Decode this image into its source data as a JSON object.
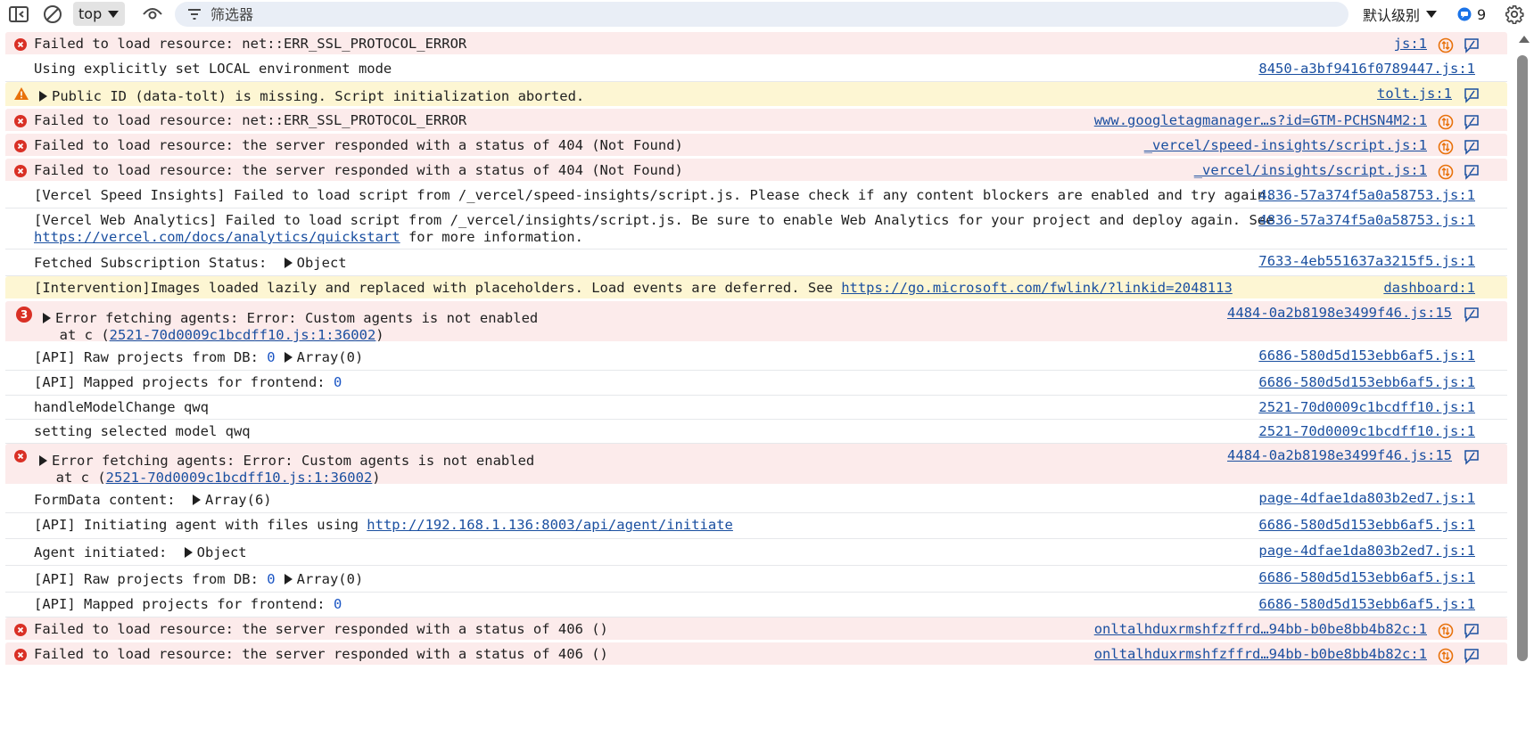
{
  "toolbar": {
    "context": "top",
    "filter_placeholder": "筛选器",
    "levels_label": "默认级别",
    "issues_count": "9"
  },
  "rows": {
    "r1": {
      "msg": "Failed to load resource: net::ERR_SSL_PROTOCOL_ERROR",
      "src": "js:1"
    },
    "r2": {
      "msg": "Using explicitly set LOCAL environment mode",
      "src": "8450-a3bf9416f0789447.js:1"
    },
    "r3": {
      "msg": "Public ID (data-tolt) is missing. Script initialization aborted.",
      "src": "tolt.js:1"
    },
    "r4": {
      "msg": "Failed to load resource: net::ERR_SSL_PROTOCOL_ERROR",
      "src": "www.googletagmanager…s?id=GTM-PCHSN4M2:1"
    },
    "r5": {
      "msg": "Failed to load resource: the server responded with a status of 404 (Not Found)",
      "src": "_vercel/speed-insights/script.js:1"
    },
    "r6": {
      "msg": "Failed to load resource: the server responded with a status of 404 (Not Found)",
      "src": "_vercel/insights/script.js:1"
    },
    "r7": {
      "msg": "[Vercel Speed Insights] Failed to load script from /_vercel/speed-insights/script.js. Please check if any content blockers are enabled and try again.",
      "src": "4836-57a374f5a0a58753.js:1"
    },
    "r8": {
      "msg1": "[Vercel Web Analytics] Failed to load script from /_vercel/insights/script.js. Be sure to enable Web Analytics for your project and deploy again. See",
      "link": "https://vercel.com/docs/analytics/quickstart",
      "msg2": " for more information.",
      "src": "4836-57a374f5a0a58753.js:1"
    },
    "r9": {
      "msg": "Fetched Subscription Status: ",
      "obj": "Object",
      "src": "7633-4eb551637a3215f5.js:1"
    },
    "r10": {
      "msg": "[Intervention]Images loaded lazily and replaced with placeholders. Load events are deferred. See ",
      "link": "https://go.microsoft.com/fwlink/?linkid=2048113",
      "src": "dashboard:1"
    },
    "r11": {
      "count": "3",
      "msg": "Error fetching agents: Error: Custom agents is not enabled",
      "at_prefix": "at c (",
      "at_link": "2521-70d0009c1bcdff10.js:1:36002",
      "at_suffix": ")",
      "src": "4484-0a2b8198e3499f46.js:15"
    },
    "r12": {
      "msg": "[API] Raw projects from DB: ",
      "num": "0",
      "obj": "Array(0)",
      "src": "6686-580d5d153ebb6af5.js:1"
    },
    "r13": {
      "msg": "[API] Mapped projects for frontend: ",
      "num": "0",
      "src": "6686-580d5d153ebb6af5.js:1"
    },
    "r14": {
      "msg": "handleModelChange qwq",
      "src": "2521-70d0009c1bcdff10.js:1"
    },
    "r15": {
      "msg": "setting selected model qwq",
      "src": "2521-70d0009c1bcdff10.js:1"
    },
    "r16": {
      "msg": "Error fetching agents: Error: Custom agents is not enabled",
      "at_prefix": "at c (",
      "at_link": "2521-70d0009c1bcdff10.js:1:36002",
      "at_suffix": ")",
      "src": "4484-0a2b8198e3499f46.js:15"
    },
    "r17": {
      "msg": "FormData content: ",
      "obj": "Array(6)",
      "src": "page-4dfae1da803b2ed7.js:1"
    },
    "r18": {
      "msg": "[API] Initiating agent with files using ",
      "link": "http://192.168.1.136:8003/api/agent/initiate",
      "src": "6686-580d5d153ebb6af5.js:1"
    },
    "r19": {
      "msg": "Agent initiated: ",
      "obj": "Object",
      "src": "page-4dfae1da803b2ed7.js:1"
    },
    "r20": {
      "msg": "[API] Raw projects from DB: ",
      "num": "0",
      "obj": "Array(0)",
      "src": "6686-580d5d153ebb6af5.js:1"
    },
    "r21": {
      "msg": "[API] Mapped projects for frontend: ",
      "num": "0",
      "src": "6686-580d5d153ebb6af5.js:1"
    },
    "r22": {
      "msg": "Failed to load resource: the server responded with a status of 406 ()",
      "src": "onltalhduxrmshfzffrd…94bb-b0be8bb4b82c:1"
    },
    "r23": {
      "msg": "Failed to load resource: the server responded with a status of 406 ()",
      "src": "onltalhduxrmshfzffrd…94bb-b0be8bb4b82c:1"
    }
  }
}
